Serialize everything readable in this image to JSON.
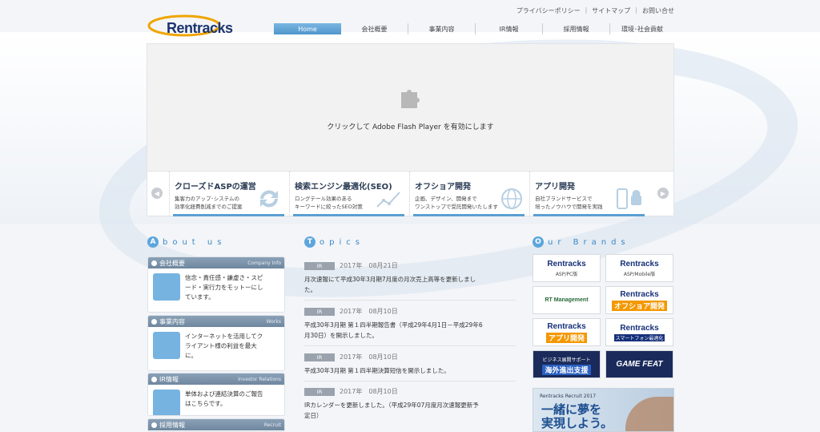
{
  "header": {
    "logo_text": "Rentracks",
    "util_links": [
      "プライバシーポリシー",
      "サイトマップ",
      "お問い合せ"
    ],
    "nav": [
      {
        "label": "Home",
        "active": true
      },
      {
        "label": "会社概要",
        "active": false
      },
      {
        "label": "事業内容",
        "active": false
      },
      {
        "label": "IR情報",
        "active": false
      },
      {
        "label": "採用情報",
        "active": false
      },
      {
        "label": "環境･社会貢献",
        "active": false
      }
    ]
  },
  "flash": {
    "message": "クリックして Adobe Flash Player を有効にします",
    "icon": "puzzle-icon"
  },
  "services": [
    {
      "title": "クローズドASPの運営",
      "desc": [
        "集客力のアップ･システムの",
        "効率化経費削減までのご提案"
      ],
      "icon": "cycle-arrows-icon"
    },
    {
      "title": "検索エンジン最適化(SEO)",
      "desc": [
        "ロングテール効果のある",
        "キーワードに絞ったSEO対策"
      ],
      "icon": "line-graph-icon"
    },
    {
      "title": "オフショア開発",
      "desc": [
        "企画、デザイン、開発まで",
        "ワンストップで受託開発いたします"
      ],
      "icon": "globe-icon"
    },
    {
      "title": "アプリ開発",
      "desc": [
        "自社ブランドサービスで",
        "培ったノウハウで開発を実践"
      ],
      "icon": "smartphone-android-icon"
    }
  ],
  "about": {
    "heading_cap": "A",
    "heading_rest": "bout us",
    "cards": [
      {
        "jp": "会社概要",
        "en": "Company Info",
        "text": [
          "信念・責任感・謙虚さ・スピ",
          "ード・実行力をモットーにし",
          "ています。"
        ]
      },
      {
        "jp": "事業内容",
        "en": "Works",
        "text": [
          "インターネットを活用してク",
          "ライアント様の利益を最大",
          "に。"
        ]
      },
      {
        "jp": "IR情報",
        "en": "Investor Relations",
        "text": [
          "単体および連結決算のご報告",
          "はこちらです。"
        ]
      },
      {
        "jp": "採用情報",
        "en": "Recruit",
        "text": []
      }
    ]
  },
  "topics": {
    "heading_cap": "T",
    "heading_rest": "opics",
    "items": [
      {
        "tag": "IR",
        "date": "2017年　08月21日",
        "body": [
          "月次速報にて平成30年3月期7月度の月次売上高等を更新しまし",
          "た。"
        ]
      },
      {
        "tag": "IR",
        "date": "2017年　08月10日",
        "body": [
          "平成30年3月期 第１四半期報告書（平成29年4月1日－平成29年6",
          "月30日）を開示しました。"
        ]
      },
      {
        "tag": "IR",
        "date": "2017年　08月10日",
        "body": [
          "平成30年3月期 第１四半期決算短信を開示しました。"
        ]
      },
      {
        "tag": "IR",
        "date": "2017年　08月10日",
        "body": [
          "IRカレンダーを更新しました。（平成29年07月度月次速報更新予",
          "定日）"
        ]
      }
    ]
  },
  "brands": {
    "heading_cap": "O",
    "heading_rest": "ur Brands",
    "items": [
      {
        "name": "Rentracks",
        "sub": "ASP/PC版"
      },
      {
        "name": "Rentracks",
        "sub": "ASP/Mobile版"
      },
      {
        "name": "RT Management",
        "sub": ""
      },
      {
        "name": "Rentracks",
        "sub": "オフショア開発"
      },
      {
        "name": "Rentracks",
        "sub": "アプリ開発"
      },
      {
        "name": "Rentracks",
        "sub": "スマートフォン最適化"
      },
      {
        "name": "ビジネス展開サポート",
        "sub": "海外進出支援"
      },
      {
        "name": "GAME FEAT",
        "sub": ""
      }
    ],
    "recruit_title": "Rentracks Recruit 2017",
    "recruit_body": [
      "一緒に夢を",
      "実現しよう。"
    ]
  }
}
